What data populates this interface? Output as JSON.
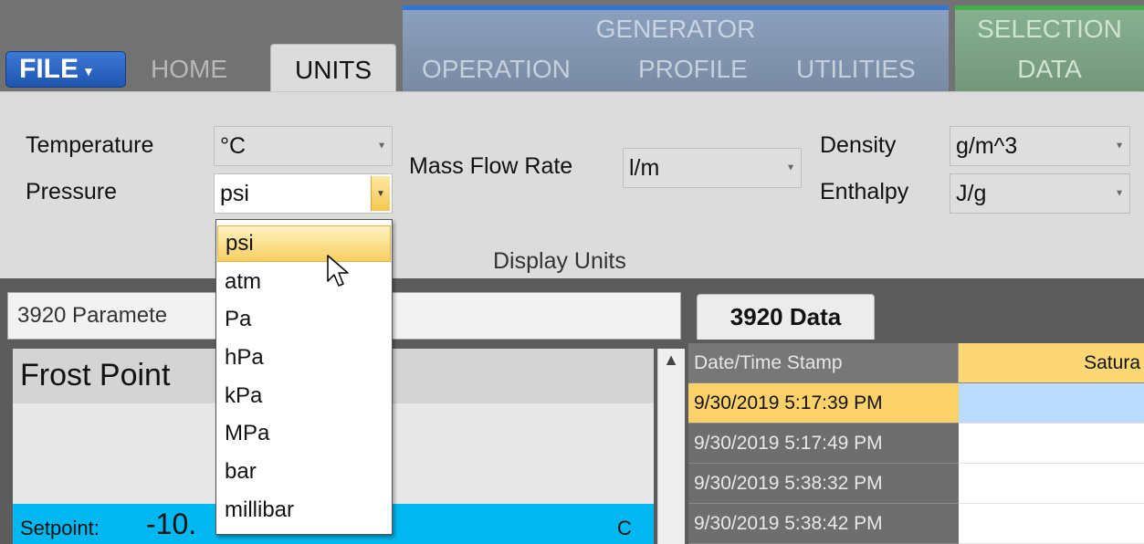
{
  "tabs": {
    "file": "FILE",
    "home": "HOME",
    "units": "UNITS",
    "generator_group": "GENERATOR",
    "operation": "OPERATION",
    "profile": "PROFILE",
    "utilities": "UTILITIES",
    "selection_group": "SELECTION",
    "data": "DATA"
  },
  "ribbon": {
    "group_label": "Display Units",
    "temperature": {
      "label": "Temperature",
      "value": "°C"
    },
    "pressure": {
      "label": "Pressure",
      "value": "psi"
    },
    "mass_flow_rate": {
      "label": "Mass Flow Rate",
      "value": "l/m"
    },
    "density": {
      "label": "Density",
      "value": "g/m^3"
    },
    "enthalpy": {
      "label": "Enthalpy",
      "value": "J/g"
    }
  },
  "pressure_options": [
    "psi",
    "atm",
    "Pa",
    "hPa",
    "kPa",
    "MPa",
    "bar",
    "millibar"
  ],
  "left_panel": {
    "parameters_title": "3920 Paramete",
    "frost_title": "Frost Point",
    "setpoint_label": "Setpoint:",
    "setpoint_value": "-10.",
    "setpoint_unit": "C"
  },
  "data_panel": {
    "tab_label": "3920 Data",
    "columns": [
      "Date/Time Stamp",
      "Satura"
    ],
    "rows": [
      "9/30/2019 5:17:39 PM",
      "9/30/2019 5:17:49 PM",
      "9/30/2019 5:38:32 PM",
      "9/30/2019 5:38:42 PM"
    ]
  },
  "colors": {
    "accent_blue": "#2f74d6",
    "accent_green": "#42b04a",
    "highlight": "#f8cf62",
    "setpoint_bar": "#00b8ef"
  }
}
